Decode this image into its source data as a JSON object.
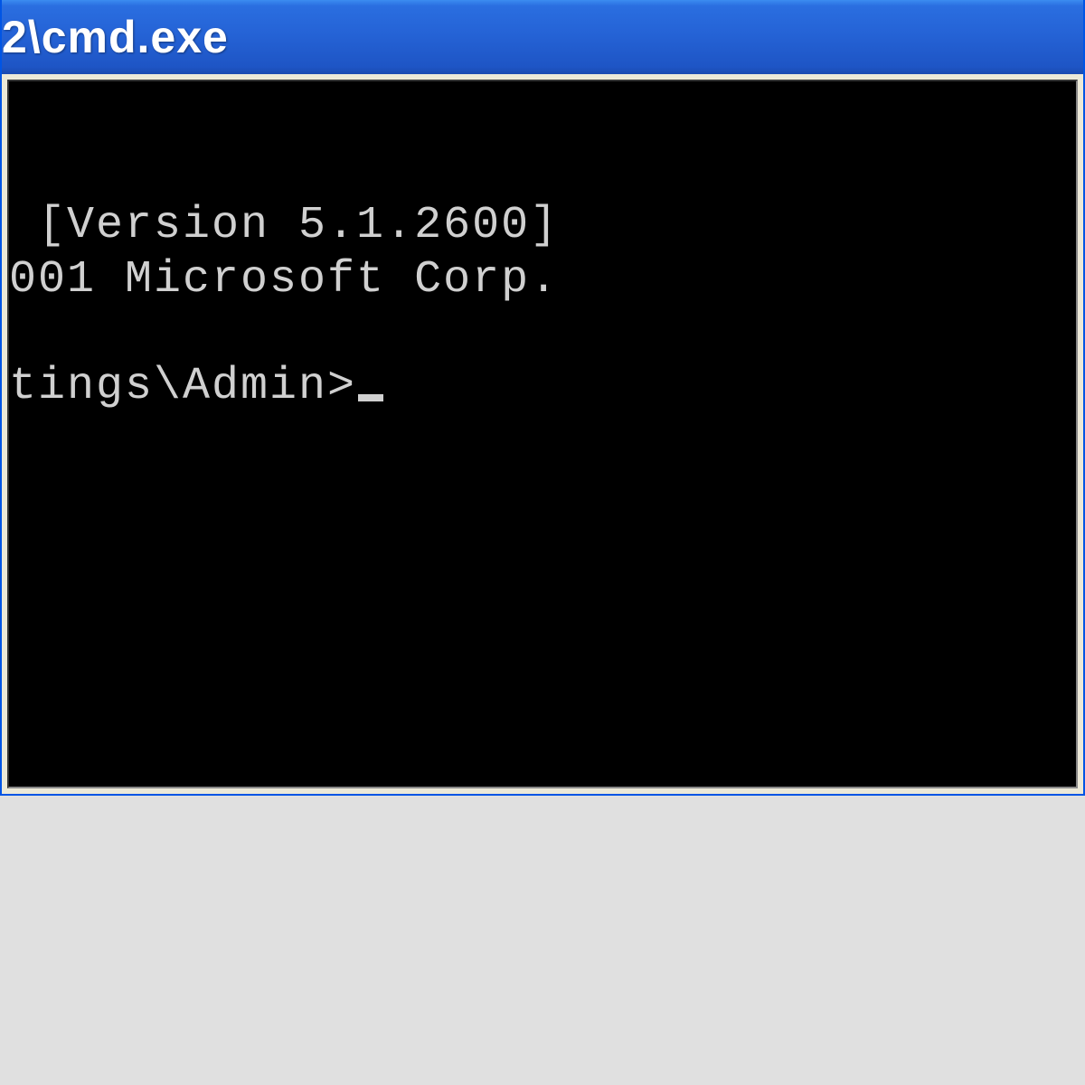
{
  "window": {
    "title": "2\\cmd.exe"
  },
  "terminal": {
    "line1": " [Version 5.1.2600]",
    "line2": "001 Microsoft Corp.",
    "prompt": "tings\\Admin>"
  },
  "colors": {
    "titlebar_start": "#3b8cf0",
    "titlebar_end": "#1a4ab0",
    "terminal_bg": "#000000",
    "terminal_fg": "#d0d0d0",
    "chrome": "#ece9d8"
  }
}
